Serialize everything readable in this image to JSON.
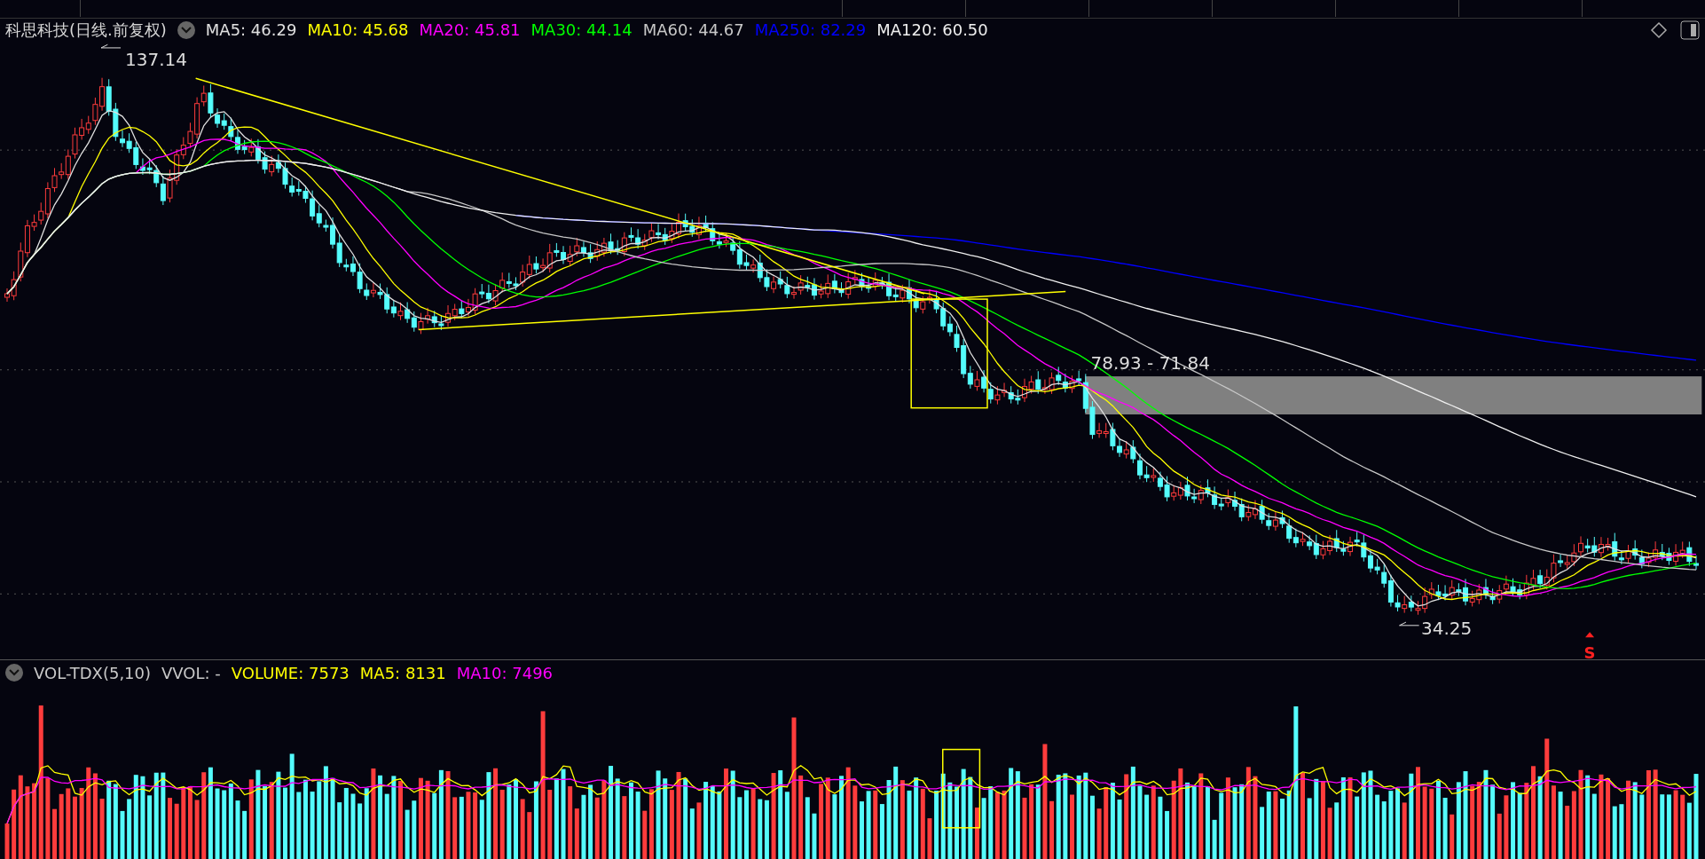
{
  "price_panel": {
    "title": "科思科技(日线.前复权)",
    "indicators": [
      {
        "label": "MA5: 46.29",
        "color": "#e0e0e0"
      },
      {
        "label": "MA10: 45.68",
        "color": "#ffff00"
      },
      {
        "label": "MA20: 45.81",
        "color": "#ff00ff"
      },
      {
        "label": "MA30: 44.14",
        "color": "#00ff00"
      },
      {
        "label": "MA60: 44.67",
        "color": "#c8c8c8"
      },
      {
        "label": "MA250: 82.29",
        "color": "#0000ff"
      },
      {
        "label": "MA120: 60.50",
        "color": "#f0f0f0"
      }
    ],
    "high_label": "137.14",
    "low_label": "34.25",
    "zone_label": "78.93 - 71.84",
    "signal_label": "S"
  },
  "volume_panel": {
    "indicators": [
      {
        "label": "VOL-TDX(5,10)",
        "color": "#c8c8c8"
      },
      {
        "label": "VVOL: -",
        "color": "#c8c8c8"
      },
      {
        "label": "VOLUME: 7573",
        "color": "#ffff00"
      },
      {
        "label": "MA5: 8131",
        "color": "#ffff00"
      },
      {
        "label": "MA10: 7496",
        "color": "#ff00ff"
      }
    ]
  }
}
